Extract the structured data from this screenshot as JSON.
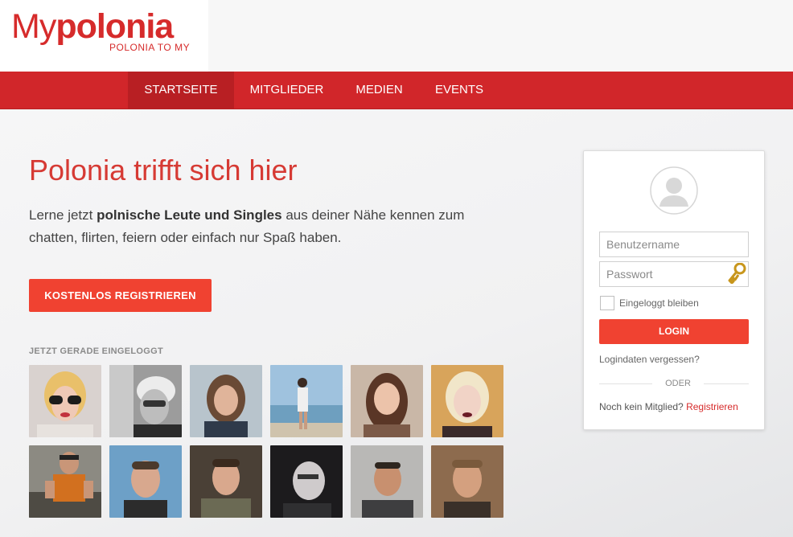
{
  "brand": {
    "logo_my": "My",
    "logo_polonia": "polonia",
    "tagline": "POLONIA TO MY",
    "accent_color": "#d1262a",
    "button_color": "#f04231"
  },
  "nav": {
    "items": [
      {
        "label": "STARTSEITE",
        "active": true
      },
      {
        "label": "MITGLIEDER",
        "active": false
      },
      {
        "label": "MEDIEN",
        "active": false
      },
      {
        "label": "EVENTS",
        "active": false
      }
    ]
  },
  "hero": {
    "title": "Polonia trifft sich hier",
    "text_before": "Lerne jetzt ",
    "text_bold": "polnische Leute und Singles",
    "text_after": " aus deiner Nähe kennen zum chatten, flirten, feiern oder einfach nur Spaß haben.",
    "register_button": "KOSTENLOS REGISTRIEREN",
    "online_label": "JETZT GERADE EINGELOGGT"
  },
  "members": [
    {
      "icon": "avatar-photo"
    },
    {
      "icon": "avatar-photo"
    },
    {
      "icon": "avatar-photo"
    },
    {
      "icon": "avatar-photo"
    },
    {
      "icon": "avatar-photo"
    },
    {
      "icon": "avatar-photo"
    },
    {
      "icon": "avatar-photo"
    },
    {
      "icon": "avatar-photo"
    },
    {
      "icon": "avatar-photo"
    },
    {
      "icon": "avatar-photo"
    },
    {
      "icon": "avatar-photo"
    },
    {
      "icon": "avatar-photo"
    }
  ],
  "login": {
    "username_placeholder": "Benutzername",
    "password_placeholder": "Passwort",
    "remember_label": "Eingeloggt bleiben",
    "login_button": "LOGIN",
    "forgot_link": "Logindaten vergessen?",
    "or_label": "ODER",
    "no_member_text": "Noch kein Mitglied?",
    "register_link": "Registrieren"
  }
}
